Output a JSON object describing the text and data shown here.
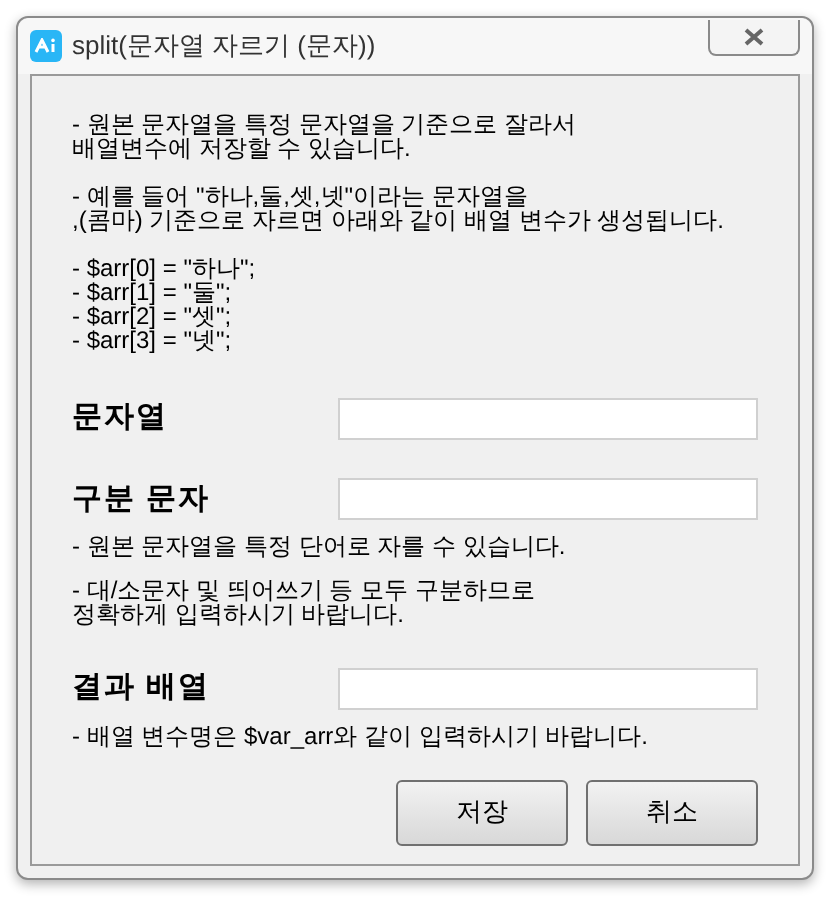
{
  "window": {
    "title": "split(문자열 자르기 (문자))"
  },
  "description": [
    [
      "- 원본 문자열을 특정 문자열을 기준으로 잘라서",
      "배열변수에 저장할 수 있습니다."
    ],
    [
      "- 예를 들어 \"하나,둘,셋,넷\"이라는 문자열을",
      ",(콤마) 기준으로 자르면 아래와 같이 배열 변수가 생성됩니다."
    ],
    [
      "- $arr[0] = \"하나\";",
      "- $arr[1] = \"둘\";",
      "- $arr[2] = \"셋\";",
      "- $arr[3] = \"넷\";"
    ]
  ],
  "fields": [
    {
      "label": "문자열"
    },
    {
      "label": "구분 문자",
      "notes": [
        [
          "- 원본 문자열을 특정 단어로 자를 수 있습니다."
        ],
        [
          "- 대/소문자 및 띄어쓰기 등 모두 구분하므로",
          "정확하게 입력하시기 바랍니다."
        ]
      ]
    },
    {
      "label": "결과 배열",
      "notes": [
        [
          "- 배열 변수명은 $var_arr와 같이 입력하시기 바랍니다."
        ]
      ]
    }
  ],
  "buttons": [
    "저장",
    "취소"
  ]
}
